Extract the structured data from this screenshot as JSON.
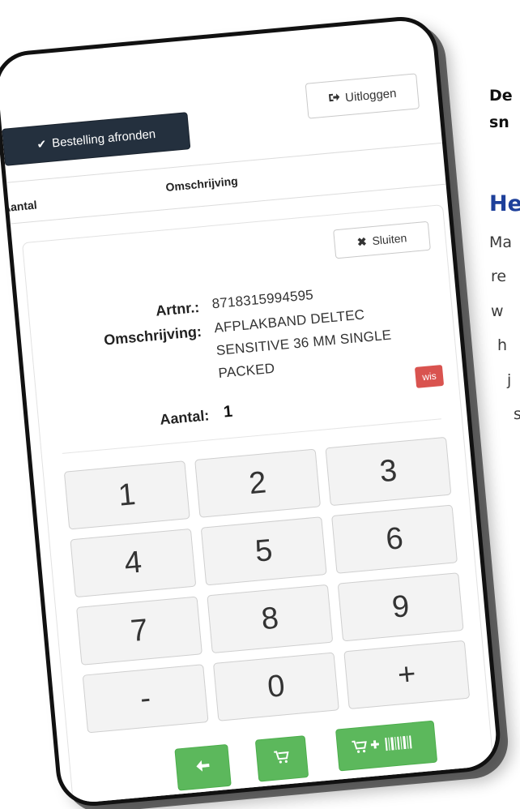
{
  "side_text": {
    "lead_lines": [
      "De",
      "sn"
    ],
    "heading": "He",
    "paragraph_lines": [
      "Ma",
      "re",
      "w",
      "h",
      "j",
      "s"
    ]
  },
  "header": {
    "finish_order_label": "Bestelling afronden",
    "logout_label": "Uitloggen"
  },
  "table": {
    "columns": [
      "Aantal",
      "Omschrijving"
    ]
  },
  "modal": {
    "close_label": "Sluiten",
    "artnr_label": "Artnr.:",
    "artnr_value": "8718315994595",
    "description_label": "Omschrijving:",
    "description_lines": [
      "AFPLAKBAND DELTEC",
      "SENSITIVE 36 MM SINGLE",
      "PACKED"
    ],
    "wis_label": "wis",
    "quantity_label": "Aantal:",
    "quantity_value": "1"
  },
  "keypad": {
    "keys": [
      "1",
      "2",
      "3",
      "4",
      "5",
      "6",
      "7",
      "8",
      "9",
      "-",
      "0",
      "+"
    ]
  },
  "actions": {
    "back_icon": "arrow-left-icon",
    "cart_icon": "cart-icon",
    "cart_plus_barcode_icon": "cart-plus-barcode-icon",
    "accent_color": "#5cb85c"
  },
  "colors": {
    "dark_button": "#24303e",
    "danger": "#d9534f",
    "heading_blue": "#1d3f9a"
  }
}
